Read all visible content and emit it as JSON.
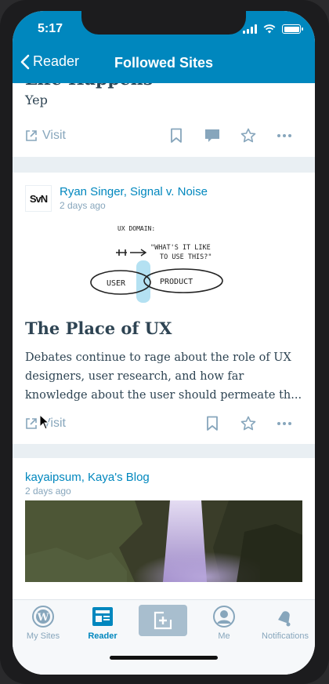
{
  "status": {
    "time": "5:17"
  },
  "nav": {
    "back_label": "Reader",
    "title": "Followed Sites"
  },
  "posts": [
    {
      "title": "Life Happens",
      "excerpt": "Yep",
      "visit_label": "Visit"
    },
    {
      "site": "Ryan Singer, Signal v. Noise",
      "site_logo": "SvN",
      "date": "2 days ago",
      "title": "The Place of UX",
      "excerpt": "Debates continue to rage about the role of UX designers, user research, and how far knowledge about the user should permeate th...",
      "visit_label": "Visit",
      "sketch": {
        "line1": "UX DOMAIN:",
        "line2": "\"WHAT'S IT LIKE",
        "line3": "TO USE THIS?\"",
        "left_label": "USER",
        "right_label": "PRODUCT"
      }
    },
    {
      "site": "kayaipsum, Kaya's Blog",
      "date": "2 days ago"
    }
  ],
  "tabs": [
    {
      "label": "My Sites",
      "icon": "wordpress-icon"
    },
    {
      "label": "Reader",
      "icon": "reader-icon"
    },
    {
      "label": "",
      "icon": "write-post-icon"
    },
    {
      "label": "Me",
      "icon": "profile-icon"
    },
    {
      "label": "Notifications",
      "icon": "bell-icon"
    }
  ],
  "colors": {
    "accent": "#0087be",
    "text": "#2e4453",
    "muted": "#87a6bc",
    "divider": "#e9eff3"
  }
}
